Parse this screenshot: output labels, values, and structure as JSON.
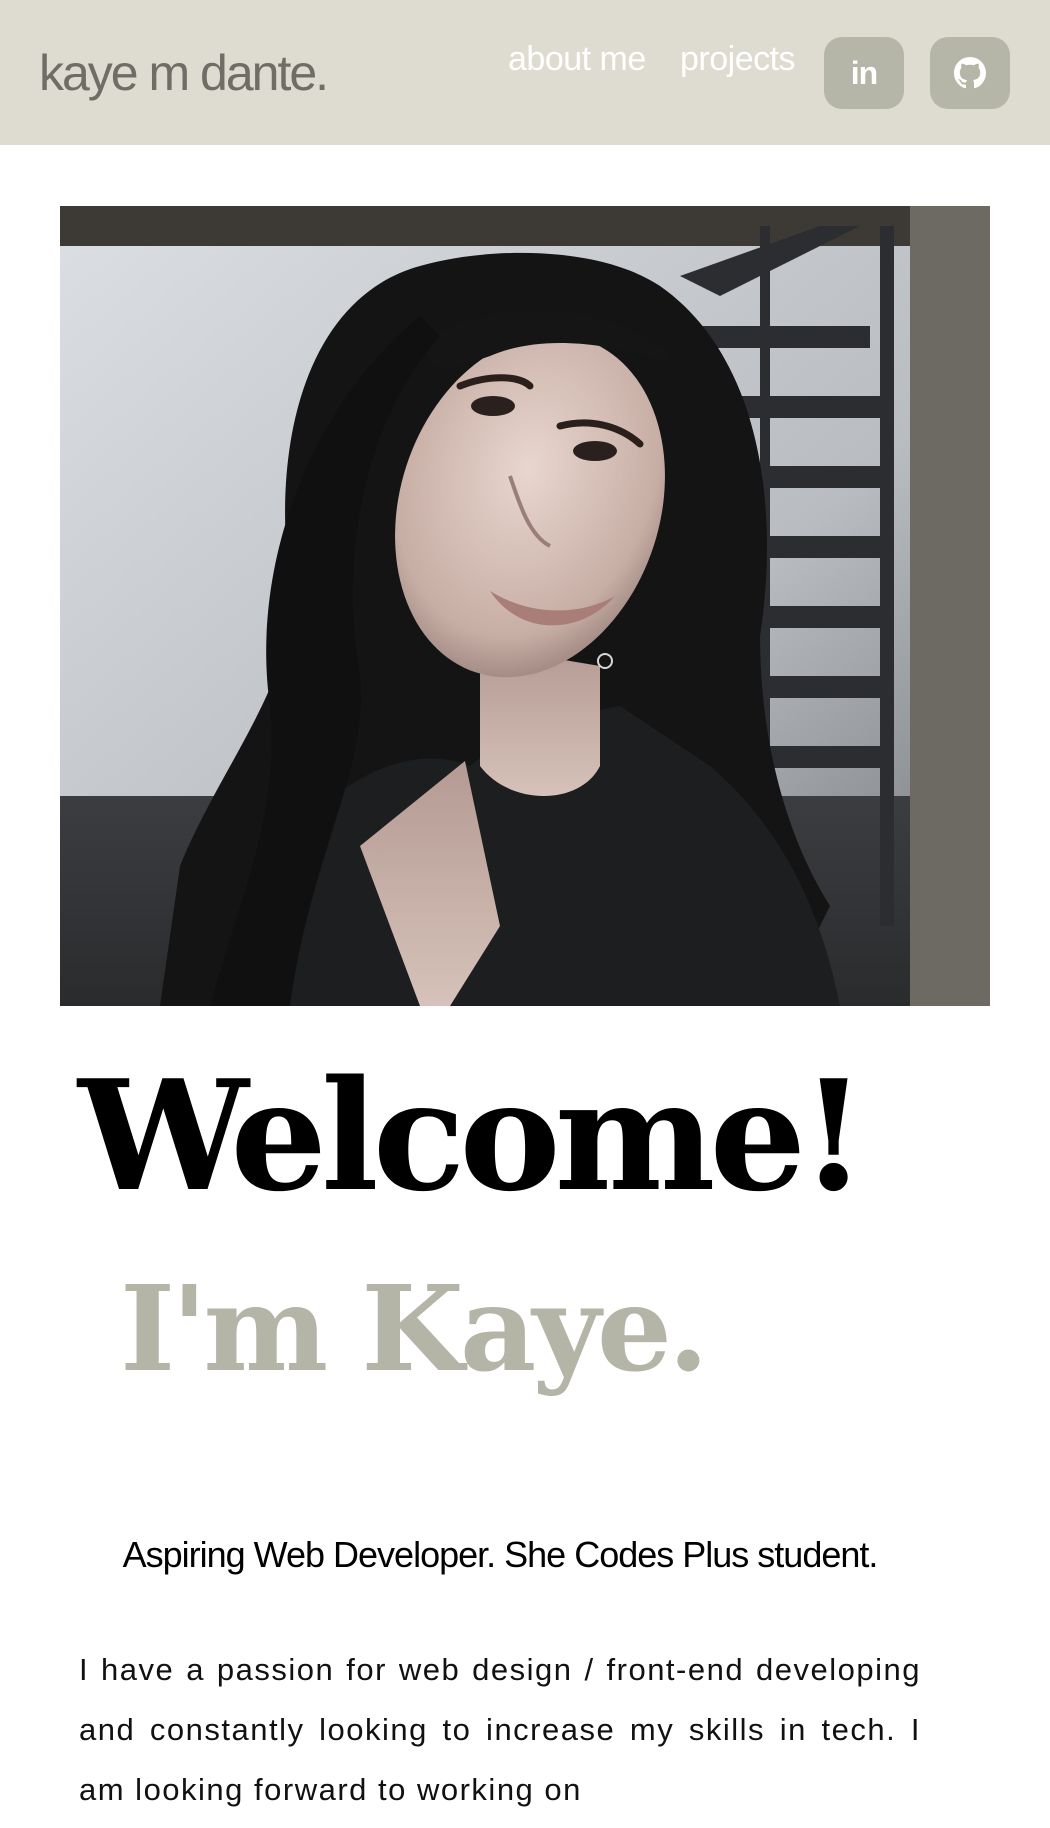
{
  "navbar": {
    "brand": "kaye m dante.",
    "links": [
      {
        "label": "about me"
      },
      {
        "label": "projects"
      }
    ],
    "social": [
      {
        "label": "in",
        "icon": "linkedin-icon"
      },
      {
        "icon": "github-icon"
      }
    ],
    "background": "#dedbd0",
    "button_color": "#b6b6a8"
  },
  "hero": {
    "photo": "portrait-photo",
    "heading": "Welcome!",
    "subheading": "I'm Kaye.",
    "subheading_color": "#b4b5a6",
    "tagline": "Aspiring Web Developer. She Codes Plus student.",
    "bio": "I have a passion for web design / front-end developing and constantly looking to increase my skills in tech. I am looking forward to working on"
  }
}
